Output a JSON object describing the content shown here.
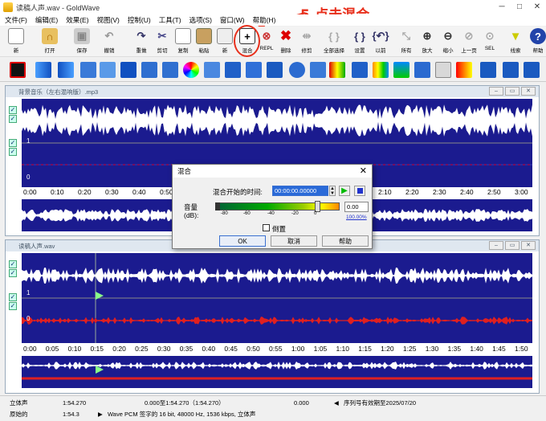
{
  "window": {
    "title": "读稿人声.wav - GoldWave",
    "min": "─",
    "max": "□",
    "close": "✕"
  },
  "annotation": "5.点击混合",
  "menu": [
    "文件(F)",
    "编辑(E)",
    "效果(E)",
    "视图(V)",
    "控制(U)",
    "工具(T)",
    "选项(S)",
    "窗口(W)",
    "帮助(H)"
  ],
  "toolbar": [
    {
      "label": "新",
      "icon": "new-icon"
    },
    {
      "label": "打开",
      "icon": "open-icon"
    },
    {
      "label": "保存",
      "icon": "save-icon"
    },
    {
      "label": "撤销",
      "icon": "undo-icon"
    },
    {
      "label": "重做",
      "icon": "redo-icon"
    },
    {
      "label": "剪切",
      "icon": "cut-icon"
    },
    {
      "label": "复制",
      "icon": "copy-icon"
    },
    {
      "label": "粘贴",
      "icon": "paste-icon"
    },
    {
      "label": "新",
      "icon": "paste-new-icon"
    },
    {
      "label": "混合",
      "icon": "mix-icon"
    },
    {
      "label": "REPL",
      "icon": "replace-icon"
    },
    {
      "label": "删除",
      "icon": "delete-icon"
    },
    {
      "label": "修剪",
      "icon": "trim-icon"
    },
    {
      "label": "全部选择",
      "icon": "select-all-icon"
    },
    {
      "label": "设置",
      "icon": "set-icon"
    },
    {
      "label": "以前",
      "icon": "previous-icon"
    },
    {
      "label": "所有",
      "icon": "all-icon"
    },
    {
      "label": "放大",
      "icon": "zoom-in-icon"
    },
    {
      "label": "缩小",
      "icon": "zoom-out-icon"
    },
    {
      "label": "上一页",
      "icon": "prev-page-icon"
    },
    {
      "label": "SEL",
      "icon": "sel-icon"
    },
    {
      "label": "线索",
      "icon": "cue-icon"
    },
    {
      "label": "帮助",
      "icon": "help-icon"
    }
  ],
  "windows": [
    {
      "title": "背景音乐（左右混响版）.mp3",
      "ch_labels": [
        "1",
        "0"
      ],
      "ticks": [
        "0:00",
        "0:10",
        "0:20",
        "0:30",
        "0:40",
        "0:50",
        "1:00",
        "1:10",
        "1:20",
        "1:30",
        "1:40",
        "1:50",
        "2:00",
        "2:10",
        "2:20",
        "2:30",
        "2:40",
        "2:50",
        "3:00"
      ]
    },
    {
      "title": "读稿人声.wav",
      "ch_labels": [
        "1",
        "0"
      ],
      "ticks": [
        "0:00",
        "0:05",
        "0:10",
        "0:15",
        "0:20",
        "0:25",
        "0:30",
        "0:35",
        "0:40",
        "0:45",
        "0:50",
        "0:55",
        "1:00",
        "1:05",
        "1:10",
        "1:15",
        "1:20",
        "1:25",
        "1:30",
        "1:35",
        "1:40",
        "1:45",
        "1:50"
      ]
    }
  ],
  "dialog": {
    "title": "混合",
    "start_label": "混合开始的时间:",
    "start_value": "00:00:00.00000",
    "volume_label": "音量(dB):",
    "scale": [
      "-80",
      "-60",
      "-40",
      "-20",
      "0"
    ],
    "volume_value": "0.00",
    "percent": "100.00%",
    "invert_label": "倒置",
    "ok": "OK",
    "cancel": "取消",
    "help": "帮助"
  },
  "status": {
    "mode": "立体声",
    "length": "1:54.270",
    "selection": "0.000至1:54.270（1:54.270）",
    "position": "0.000",
    "registration": "序列号有效期至2025/07/20",
    "original_label": "原始的",
    "original_length": "1:54.3",
    "format": "Wave PCM 签字的 16 bit, 48000 Hz, 1536 kbps, 立体声"
  },
  "colors": {
    "accent": "#e8301c",
    "wave_bg": "#1b1b8f",
    "wave_white": "#ffffff",
    "wave_red": "#e02020"
  }
}
